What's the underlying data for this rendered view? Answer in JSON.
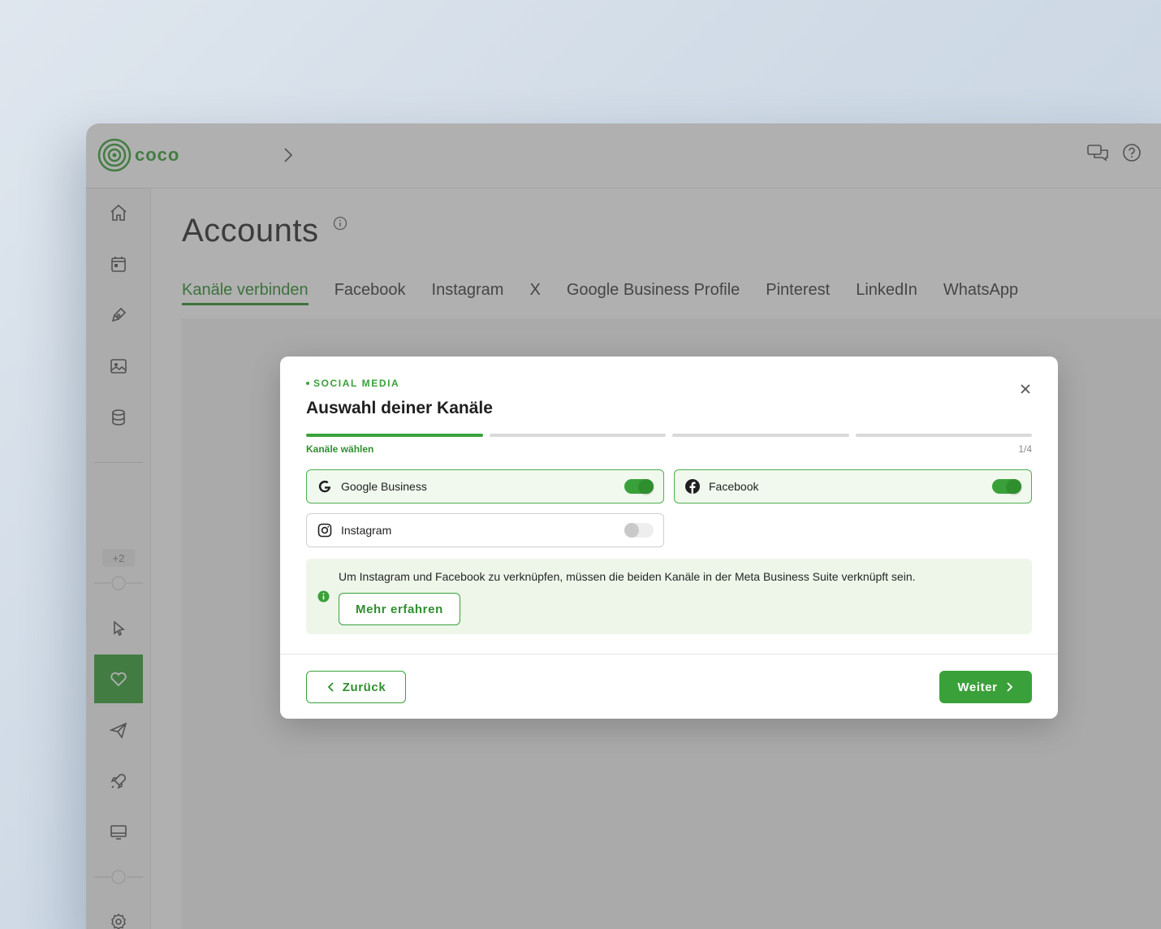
{
  "app": {
    "logo_text": "coco",
    "sidebar": {
      "badge": "+2"
    }
  },
  "page": {
    "title": "Accounts",
    "tabs": [
      {
        "label": "Kanäle verbinden",
        "active": true
      },
      {
        "label": "Facebook"
      },
      {
        "label": "Instagram"
      },
      {
        "label": "X"
      },
      {
        "label": "Google Business Profile"
      },
      {
        "label": "Pinterest"
      },
      {
        "label": "LinkedIn"
      },
      {
        "label": "WhatsApp"
      }
    ]
  },
  "modal": {
    "eyebrow": "SOCIAL MEDIA",
    "title": "Auswahl deiner Kanäle",
    "step_label": "Kanäle wählen",
    "step_count": "1/4",
    "steps_total": 4,
    "steps_done": 1,
    "channels": [
      {
        "label": "Google Business",
        "enabled": true,
        "icon": "google-icon"
      },
      {
        "label": "Facebook",
        "enabled": true,
        "icon": "facebook-icon"
      },
      {
        "label": "Instagram",
        "enabled": false,
        "icon": "instagram-icon"
      }
    ],
    "info_text": "Um Instagram und Facebook zu verknüpfen, müssen die beiden Kanäle in der Meta Business Suite verknüpft sein.",
    "more_button": "Mehr erfahren",
    "back_button": "Zurück",
    "next_button": "Weiter"
  },
  "colors": {
    "accent": "#3aa13a",
    "accent_dark": "#2f8f2f",
    "accent_bg": "#f1f9ee"
  }
}
